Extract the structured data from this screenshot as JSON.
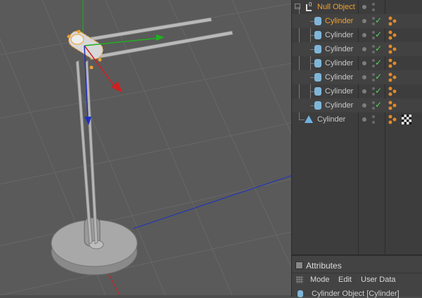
{
  "object_manager": {
    "rows": [
      {
        "label": "Null Object",
        "kind": "null",
        "selected": true
      },
      {
        "label": "Cylinder",
        "kind": "cylinder",
        "selected": true
      },
      {
        "label": "Cylinder",
        "kind": "cylinder",
        "selected": false
      },
      {
        "label": "Cylinder",
        "kind": "cylinder",
        "selected": false
      },
      {
        "label": "Cylinder",
        "kind": "cylinder",
        "selected": false
      },
      {
        "label": "Cylinder",
        "kind": "cylinder",
        "selected": false
      },
      {
        "label": "Cylinder",
        "kind": "cylinder",
        "selected": false
      },
      {
        "label": "Cylinder",
        "kind": "cylinder",
        "selected": false
      },
      {
        "label": "Cylinder",
        "kind": "cone",
        "selected": false
      }
    ],
    "null_badge": "0",
    "enabled_check": "✓"
  },
  "attributes": {
    "title": "Attributes",
    "menu": {
      "mode": "Mode",
      "edit": "Edit",
      "user_data": "User Data"
    },
    "object_title": "Cylinder Object [Cylinder]"
  },
  "colors": {
    "viewport_bg": "#5a5a5a",
    "grid": "#6b6b6b",
    "axis_x": "#d02020",
    "axis_y": "#20b020",
    "axis_z": "#2030c0",
    "selected_text": "#f0a030",
    "check": "#58d058",
    "tag_orange": "#e08a2a"
  },
  "icons": {
    "null": "null-object-icon",
    "cylinder": "cylinder-icon",
    "cone": "cone-icon",
    "tag": "material-tag-icon",
    "checker": "checker-texture-icon"
  }
}
